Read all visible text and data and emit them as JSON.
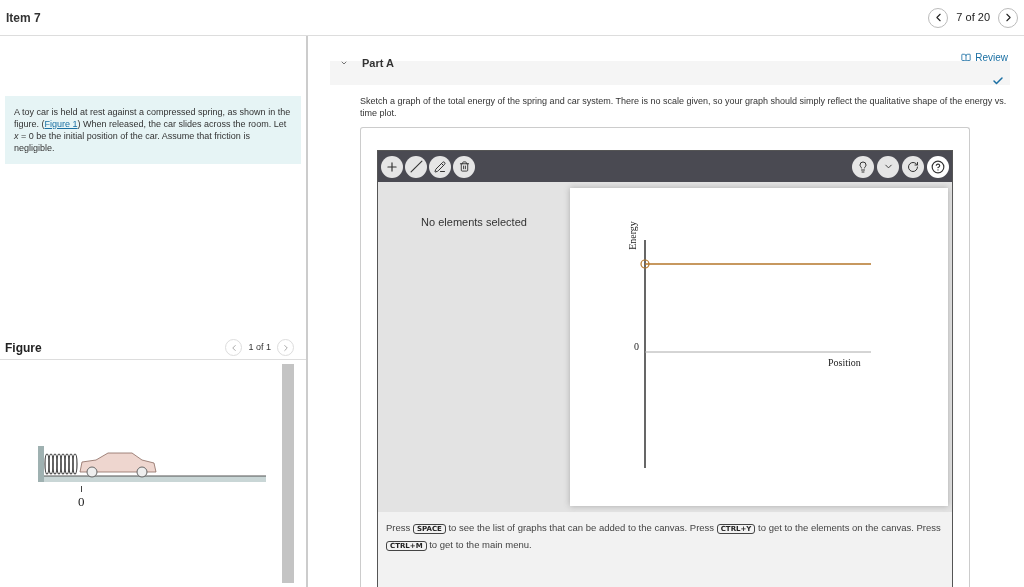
{
  "header": {
    "title": "Item 7",
    "counter": "7 of 20"
  },
  "problem": {
    "before": "A toy car is held at rest against a compressed spring, as shown in the figure. (",
    "link": "Figure 1",
    "after": ") When released, the car slides across the room. Let *x* = 0 be the initial position of the car. Assume that friction is negligible."
  },
  "figure": {
    "title": "Figure",
    "counter": "1 of 1",
    "origin_label": "0"
  },
  "review": "Review",
  "part": {
    "title": "Part A",
    "expanded": true,
    "answered": true
  },
  "question": "Sketch a graph of the total energy of the spring and car system. There is no scale given, so your graph should simply reflect the qualitative shape of the energy vs. time plot.",
  "tool": {
    "status": "No elements selected",
    "graph": {
      "ylabel": "Energy",
      "xlabel": "Position",
      "zero": "0"
    },
    "instructions": [
      {
        "kind": "text",
        "text": "Press "
      },
      {
        "kind": "key",
        "text": "SPACE"
      },
      {
        "kind": "text",
        "text": " to see the list of graphs that can be added to the canvas. Press "
      },
      {
        "kind": "key",
        "text": "CTRL+Y"
      },
      {
        "kind": "text",
        "text": " to get to the elements on the canvas. Press "
      },
      {
        "kind": "key",
        "text": "CTRL+M"
      },
      {
        "kind": "text",
        "text": " to get to the main menu."
      }
    ]
  }
}
